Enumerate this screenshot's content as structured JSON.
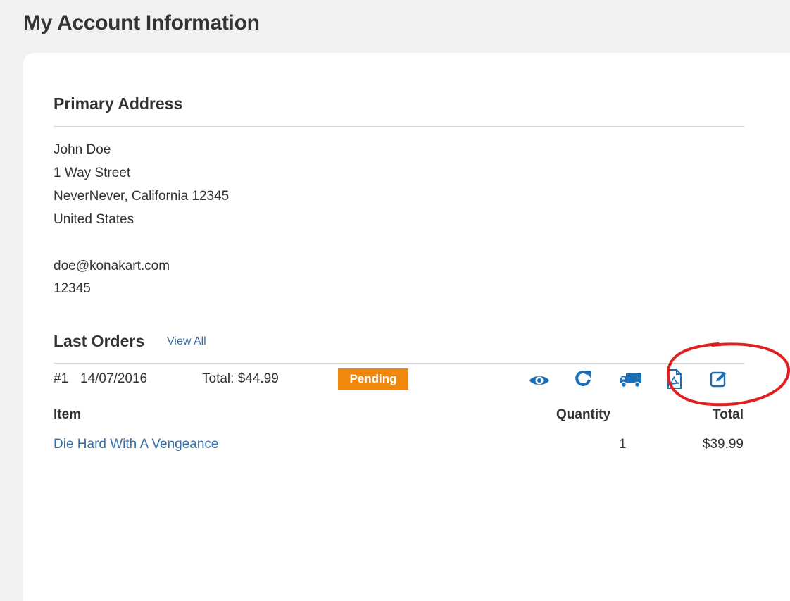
{
  "page": {
    "title": "My Account Information"
  },
  "address": {
    "heading": "Primary Address",
    "name": "John Doe",
    "street": "1 Way Street",
    "city_line": "NeverNever, California 12345",
    "country": "United States",
    "email": "doe@konakart.com",
    "phone": "12345"
  },
  "orders": {
    "heading": "Last Orders",
    "view_all": "View All",
    "order": {
      "id": "#1",
      "date": "14/07/2016",
      "total": "Total: $44.99",
      "status": "Pending",
      "status_color": "#f0870e",
      "actions": [
        {
          "name": "view-order-icon",
          "icon": "eye"
        },
        {
          "name": "repeat-order-icon",
          "icon": "refresh"
        },
        {
          "name": "track-shipment-icon",
          "icon": "truck"
        },
        {
          "name": "invoice-pdf-icon",
          "icon": "pdf-file"
        },
        {
          "name": "edit-order-icon",
          "icon": "edit"
        }
      ]
    },
    "columns": {
      "item": "Item",
      "quantity": "Quantity",
      "total": "Total"
    },
    "items": [
      {
        "name": "Die Hard With A Vengeance",
        "quantity": "1",
        "total": "$39.99"
      }
    ]
  },
  "colors": {
    "accent": "#1b6fb5",
    "link": "#3a6ea5",
    "annotation": "#e02020"
  }
}
